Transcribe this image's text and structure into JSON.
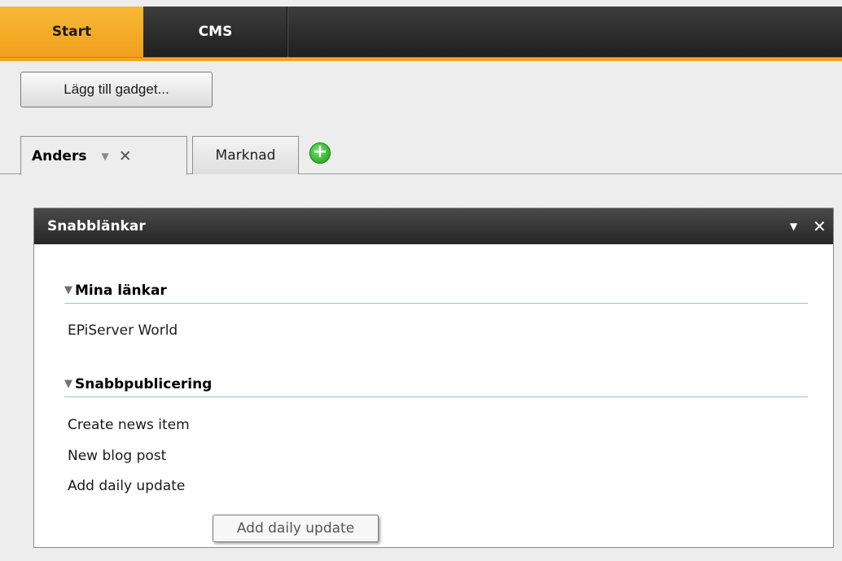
{
  "topnav": {
    "tabs": [
      {
        "label": "Start",
        "active": true
      },
      {
        "label": "CMS",
        "active": false
      }
    ],
    "accent_color": "#f1a520"
  },
  "toolbar": {
    "add_gadget_label": "Lägg till gadget..."
  },
  "dashboard_tabs": {
    "tabs": [
      {
        "label": "Anders",
        "active": true
      },
      {
        "label": "Marknad",
        "active": false
      }
    ],
    "add_icon": "plus-circle-icon"
  },
  "gadget": {
    "title": "Snabblänkar",
    "sections": [
      {
        "title": "Mina länkar",
        "links": [
          "EPiServer World"
        ]
      },
      {
        "title": "Snabbpublicering",
        "links": [
          "Create news item",
          "New blog post",
          "Add daily update"
        ]
      }
    ]
  },
  "tooltip": {
    "text": "Add daily update"
  }
}
